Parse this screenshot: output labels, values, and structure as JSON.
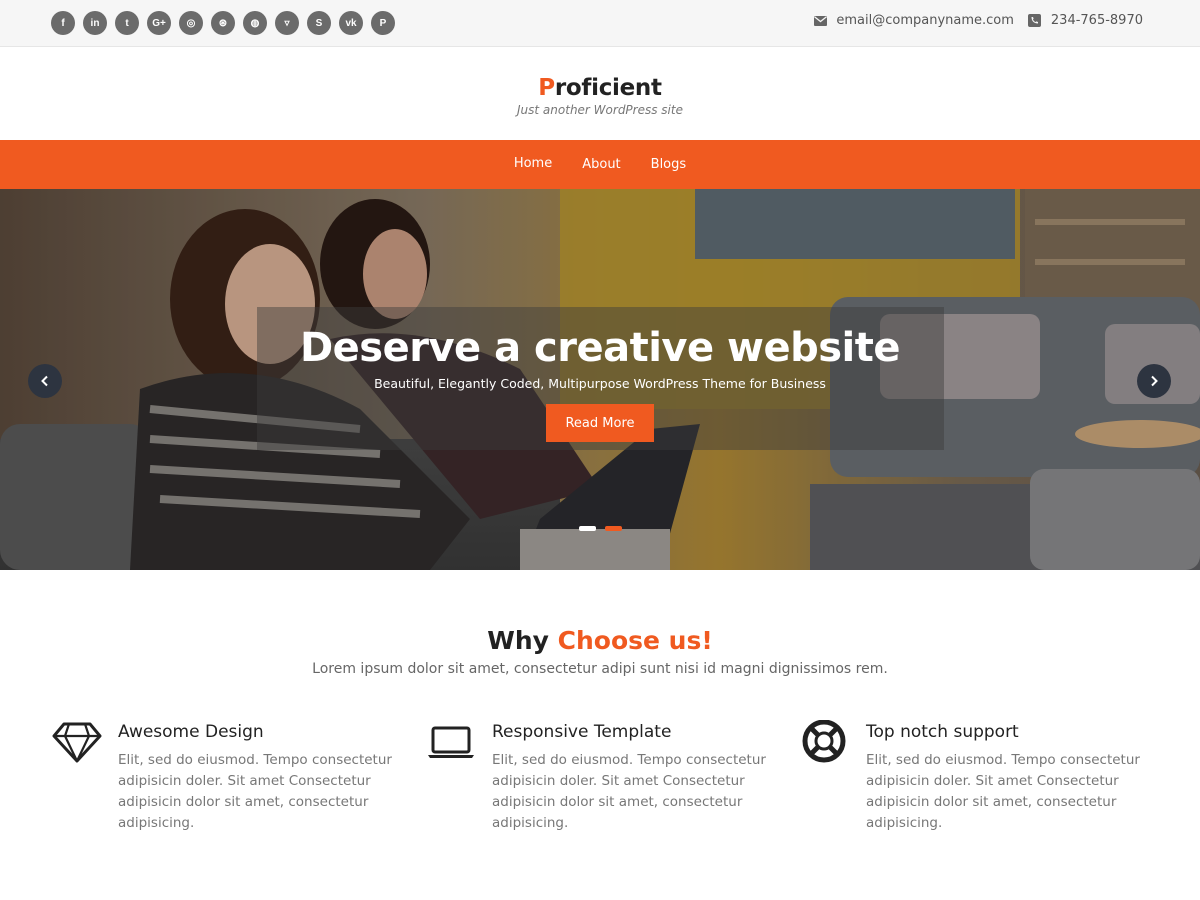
{
  "topbar": {
    "social_icons": [
      {
        "name": "facebook-icon",
        "glyph": "f"
      },
      {
        "name": "linkedin-icon",
        "glyph": "in"
      },
      {
        "name": "twitter-icon",
        "glyph": "t"
      },
      {
        "name": "google-plus-icon",
        "glyph": "G+"
      },
      {
        "name": "instagram-icon",
        "glyph": "◎"
      },
      {
        "name": "dribbble-icon",
        "glyph": "⊛"
      },
      {
        "name": "github-icon",
        "glyph": "◍"
      },
      {
        "name": "foursquare-icon",
        "glyph": "▿"
      },
      {
        "name": "skype-icon",
        "glyph": "S"
      },
      {
        "name": "vk-icon",
        "glyph": "vk"
      },
      {
        "name": "pinterest-icon",
        "glyph": "P"
      }
    ],
    "email": "email@companyname.com",
    "phone": "234-765-8970"
  },
  "brand": {
    "title_first": "P",
    "title_rest": "roficient",
    "tagline": "Just another WordPress site"
  },
  "nav": {
    "items": [
      "Home",
      "About",
      "Blogs"
    ]
  },
  "hero": {
    "title": "Deserve a creative website",
    "subtitle": "Beautiful, Elegantly Coded, Multipurpose WordPress Theme for Business",
    "button": "Read More",
    "slide_count": 2,
    "active_slide": 2
  },
  "why": {
    "title_plain": "Why ",
    "title_accent": "Choose us!",
    "subtitle": "Lorem ipsum dolor sit amet, consectetur adipi sunt nisi id magni dignissimos rem."
  },
  "features": [
    {
      "icon": "diamond-icon",
      "title": "Awesome Design",
      "text": "Elit, sed do eiusmod. Tempo consectetur adipisicin doler. Sit amet Consectetur adipisicin dolor sit amet, consectetur adipisicing."
    },
    {
      "icon": "laptop-icon",
      "title": "Responsive Template",
      "text": "Elit, sed do eiusmod. Tempo consectetur adipisicin doler. Sit amet Consectetur adipisicin dolor sit amet, consectetur adipisicing."
    },
    {
      "icon": "lifebuoy-icon",
      "title": "Top notch support",
      "text": "Elit, sed do eiusmod. Tempo consectetur adipisicin doler. Sit amet Consectetur adipisicin dolor sit amet, consectetur adipisicing."
    }
  ],
  "colors": {
    "accent": "#f05a20",
    "topbar_bg": "#f6f6f6",
    "social_bg": "#6b6b6b",
    "arrow_bg": "#2d3440"
  }
}
